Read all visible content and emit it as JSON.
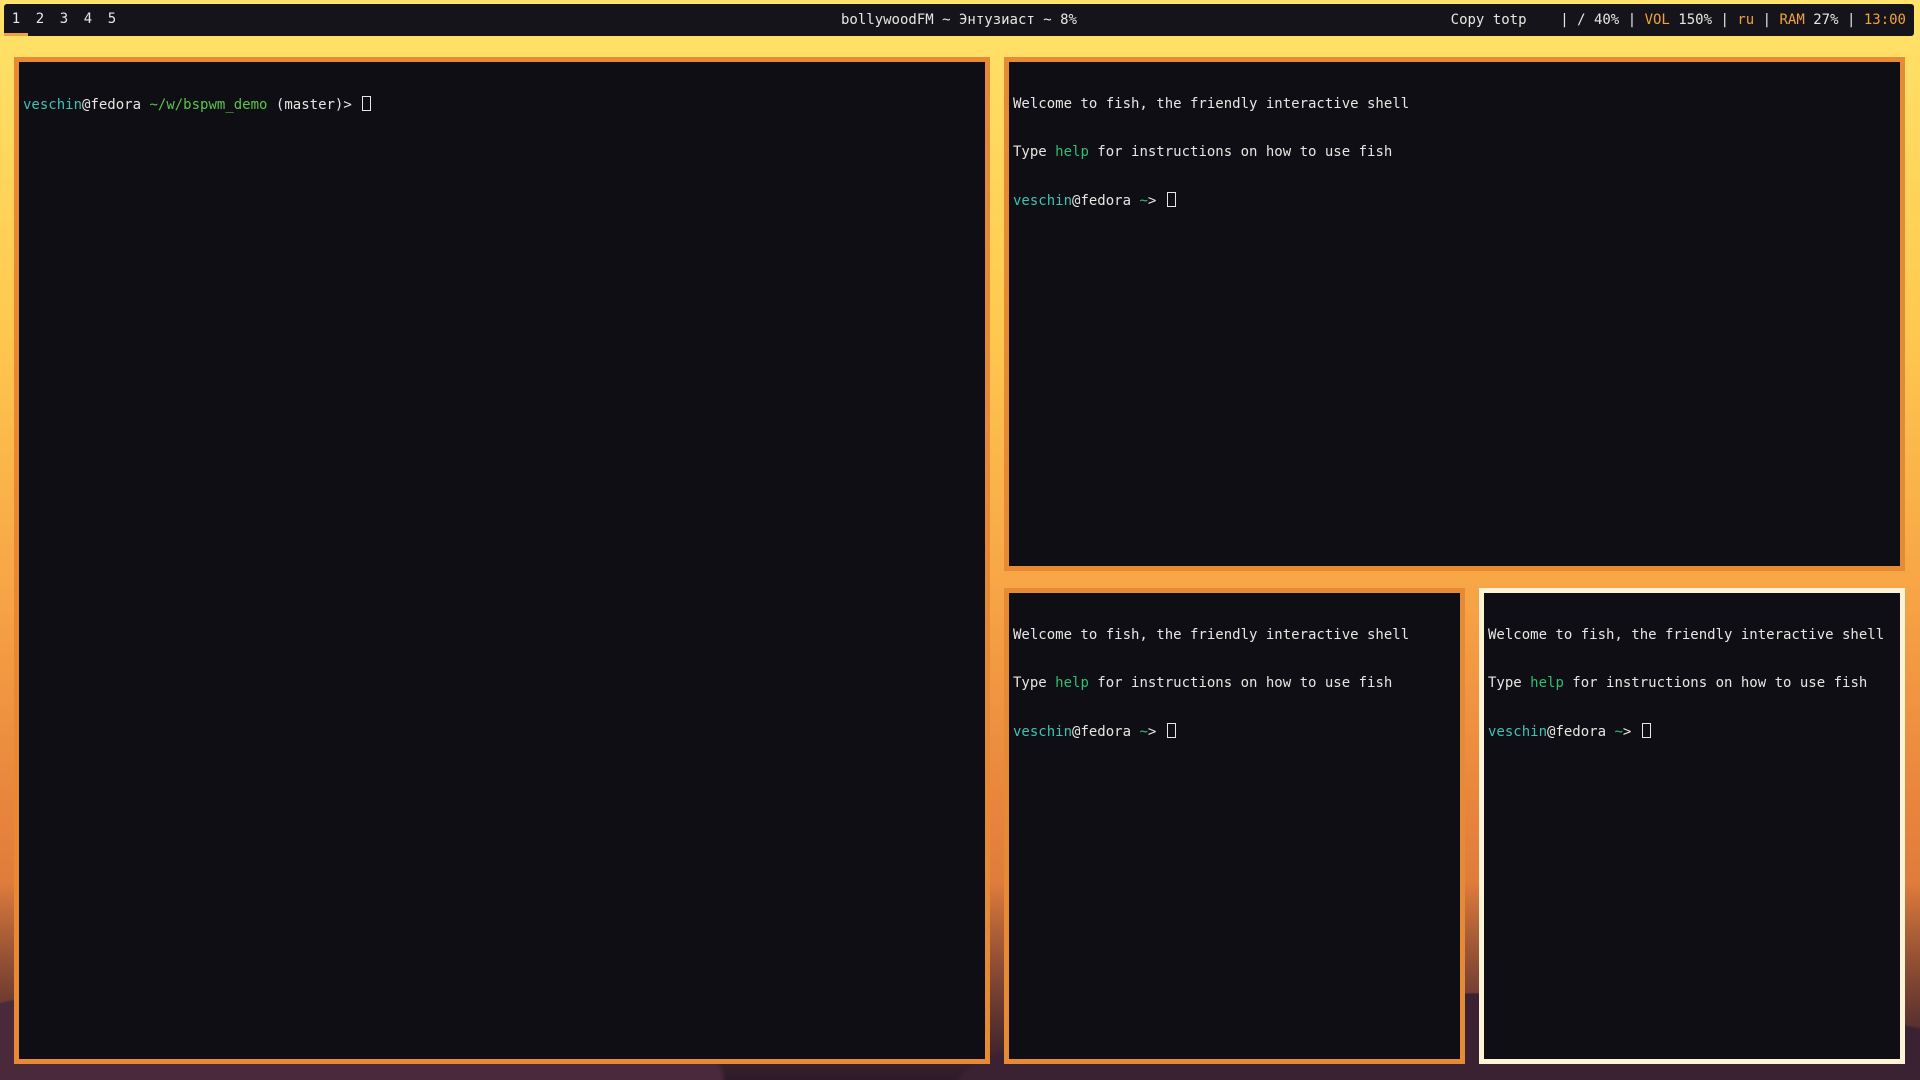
{
  "bar": {
    "workspaces": [
      "1",
      "2",
      "3",
      "4",
      "5"
    ],
    "active_workspace": "1",
    "now_playing": "bollywoodFM ~ Энтузиаст ~ 8%",
    "copy_label": "Copy totp",
    "disk": "/ 40%",
    "vol_label": "VOL",
    "vol_value": "150%",
    "lang": "ru",
    "ram_label": "RAM",
    "ram_value": "27%",
    "clock": "13:00",
    "separator": "|"
  },
  "terminals": {
    "left": {
      "user": "veschin",
      "host": "@fedora",
      "path": "~/w/bspwm_demo",
      "branch": "(master)>"
    },
    "top_right": {
      "welcome": "Welcome to fish, the friendly interactive shell",
      "type_pre": "Type ",
      "help": "help",
      "type_post": " for instructions on how to use fish",
      "user": "veschin",
      "host": "@fedora",
      "tilde": "~",
      "prompt_end": ">"
    },
    "bottom_middle": {
      "welcome": "Welcome to fish, the friendly interactive shell",
      "type_pre": "Type ",
      "help": "help",
      "type_post": " for instructions on how to use fish",
      "user": "veschin",
      "host": "@fedora",
      "tilde": "~",
      "prompt_end": ">"
    },
    "bottom_right": {
      "welcome": "Welcome to fish, the friendly interactive shell",
      "type_pre": "Type ",
      "help": "help",
      "type_post": " for instructions on how to use fish",
      "user": "veschin",
      "host": "@fedora",
      "tilde": "~",
      "prompt_end": ">"
    }
  },
  "colors": {
    "border": "#e78a35",
    "focused_border": "#fdf3d6",
    "terminal_bg": "#0f0e14",
    "bar_bg": "#15141b",
    "accent": "#f0a33a"
  }
}
